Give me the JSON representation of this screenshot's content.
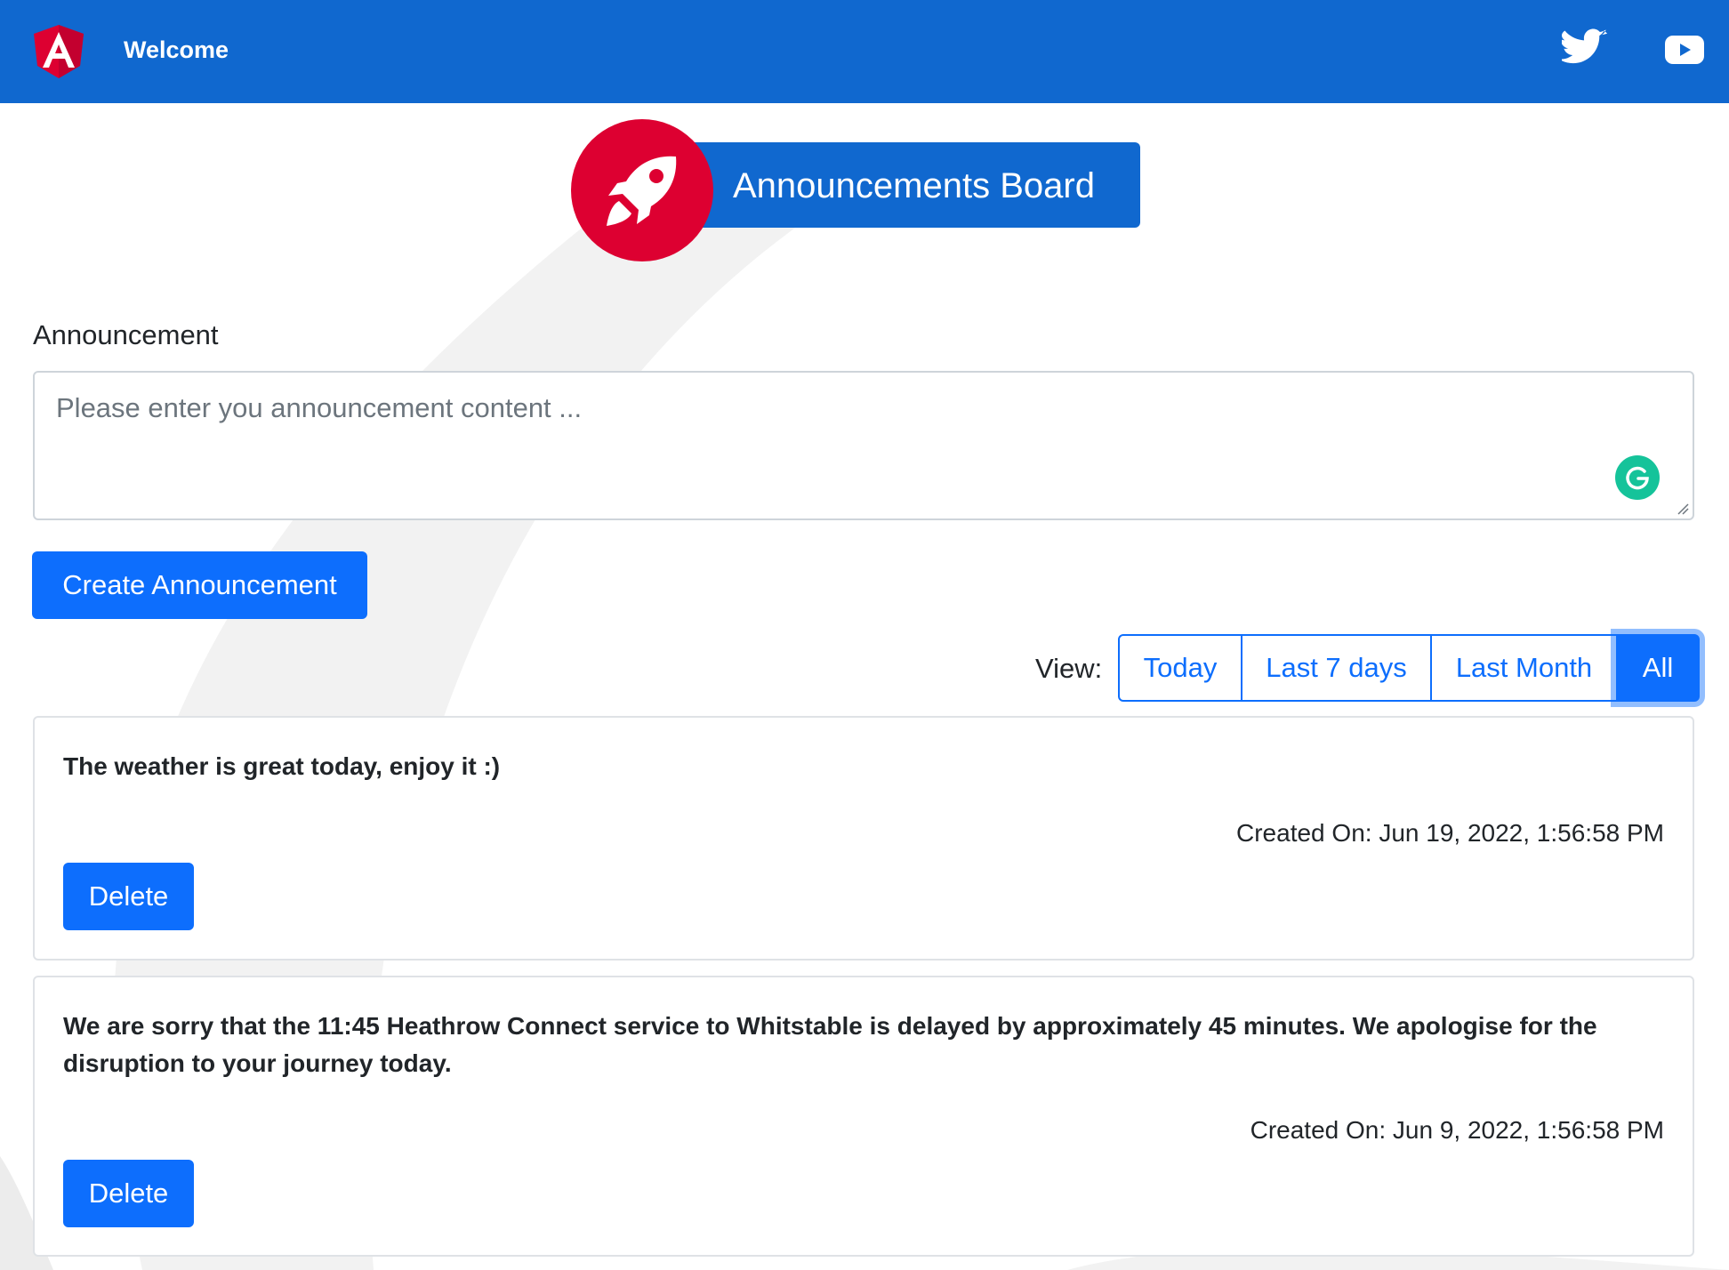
{
  "header": {
    "title": "Welcome",
    "bg_color": "#1068cf",
    "logo_icon": "angular-logo-icon",
    "social": [
      {
        "name": "twitter-icon"
      },
      {
        "name": "youtube-icon"
      }
    ]
  },
  "banner": {
    "title": "Announcements Board",
    "icon": "rocket-icon",
    "circle_color": "#dd0031"
  },
  "form": {
    "label": "Announcement",
    "placeholder": "Please enter you announcement content ...",
    "value": "",
    "submit_label": "Create Announcement"
  },
  "filter": {
    "label": "View:",
    "options": [
      "Today",
      "Last 7 days",
      "Last Month",
      "All"
    ],
    "selected": "All"
  },
  "announcements": [
    {
      "content": "The weather is great today, enjoy it :)",
      "created": "Created On: Jun 19, 2022, 1:56:58 PM",
      "delete_label": "Delete"
    },
    {
      "content": "We are sorry that the 11:45 Heathrow Connect service to Whitstable is delayed by approximately 45 minutes. We apologise for the disruption to your journey today.",
      "created": "Created On: Jun 9, 2022, 1:56:58 PM",
      "delete_label": "Delete"
    }
  ],
  "colors": {
    "primary": "#0d6efd",
    "grammarly": "#15c39a"
  }
}
